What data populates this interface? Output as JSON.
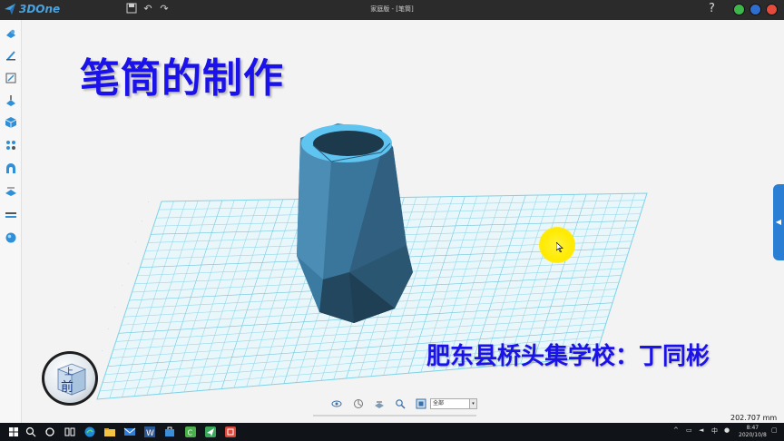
{
  "app": {
    "logo_text": "3DOne",
    "window_title": "家庭版 - [笔筒]",
    "help_label": "?"
  },
  "colors": {
    "accent_blue": "#2a7fd4",
    "heading_blue": "#1a12e8",
    "model_blue": "#3d7fa6",
    "grid_cyan": "#7fd3e8",
    "highlight_yellow": "#ffea00",
    "min_button": "#3cb84a",
    "max_button": "#2d6fd1",
    "close_button": "#e64a3b"
  },
  "left_toolbar": {
    "items": [
      "basic-shapes-icon",
      "sketch-icon",
      "sketch-edit-icon",
      "feature-icon",
      "special-function-icon",
      "basic-edit-icon",
      "combine-icon",
      "distance-icon",
      "assembly-icon",
      "render-icon"
    ]
  },
  "canvas": {
    "heading": "笔筒的制作",
    "author": "肥东县桥头集学校：丁同彬"
  },
  "viewcube": {
    "front_label": "前",
    "top_label": "上"
  },
  "view_toolbar": {
    "icons": [
      "eye-icon",
      "view-icon",
      "render-mode-icon",
      "zoom-icon",
      "fit-view-icon"
    ],
    "selected": "全部"
  },
  "status": {
    "dimension": "202.707 mm"
  },
  "taskbar": {
    "apps": [
      "windows-start-icon",
      "search-icon",
      "cortana-icon",
      "task-view-icon",
      "edge-icon",
      "file-explorer-icon",
      "mail-icon",
      "word-icon",
      "store-icon",
      "camtasia-icon",
      "3done-icon",
      "recorder-icon"
    ],
    "time": "8:47",
    "date": "2020/10/8"
  }
}
